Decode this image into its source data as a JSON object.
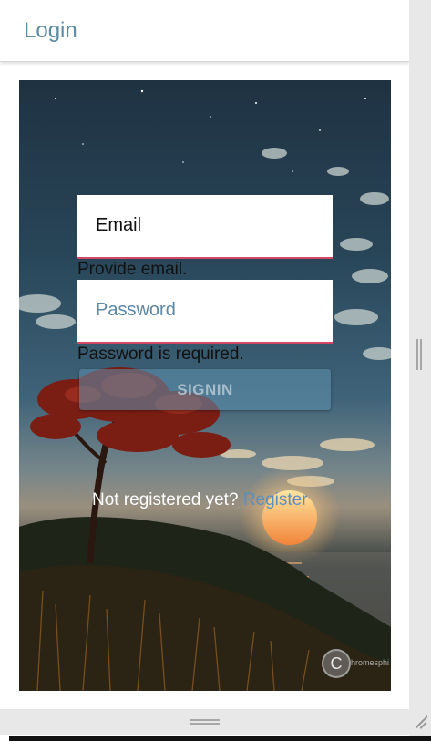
{
  "header": {
    "title": "Login"
  },
  "form": {
    "email_placeholder": "Email",
    "email_error": "Provide email.",
    "password_placeholder": "Password",
    "password_error": "Password is required.",
    "signin_label": "SIGNIN"
  },
  "register": {
    "prompt": "Not registered yet?",
    "link_label": "Register"
  },
  "watermark": {
    "letter": "C",
    "text": "hromesphi"
  },
  "colors": {
    "title": "#5b8aa5",
    "field_underline": "#d24865",
    "link": "#5b8fc0",
    "button_bg": "#5f91af"
  }
}
